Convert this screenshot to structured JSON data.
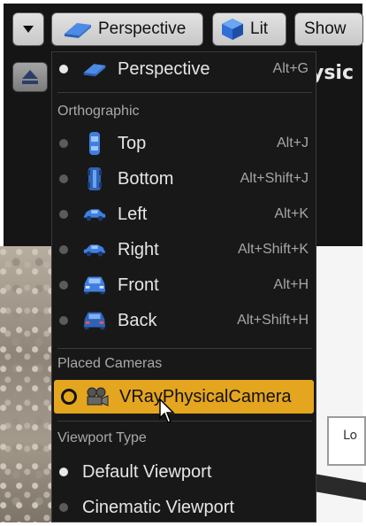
{
  "toolbar": {
    "perspective_label": "Perspective",
    "lit_label": "Lit",
    "show_label": "Show"
  },
  "viewport_title_fragment": "ysic",
  "scene_box_text": "Lo",
  "menu": {
    "top_item": {
      "label": "Perspective",
      "shortcut": "Alt+G"
    },
    "orthographic_header": "Orthographic",
    "ortho_items": [
      {
        "label": "Top",
        "shortcut": "Alt+J"
      },
      {
        "label": "Bottom",
        "shortcut": "Alt+Shift+J"
      },
      {
        "label": "Left",
        "shortcut": "Alt+K"
      },
      {
        "label": "Right",
        "shortcut": "Alt+Shift+K"
      },
      {
        "label": "Front",
        "shortcut": "Alt+H"
      },
      {
        "label": "Back",
        "shortcut": "Alt+Shift+H"
      }
    ],
    "placed_cameras_header": "Placed Cameras",
    "camera_item": {
      "label": "VRayPhysicalCamera"
    },
    "viewport_type_header": "Viewport Type",
    "viewport_types": [
      {
        "label": "Default Viewport"
      },
      {
        "label": "Cinematic Viewport"
      }
    ]
  },
  "colors": {
    "highlight": "#e4a51f",
    "menu_bg": "#181818",
    "icon_blue": "#3f7fe0"
  },
  "icons": [
    "chevron-down-icon",
    "perspective-icon",
    "lit-sphere-icon",
    "eject-icon",
    "camera-icon",
    "mouse-cursor-icon"
  ]
}
